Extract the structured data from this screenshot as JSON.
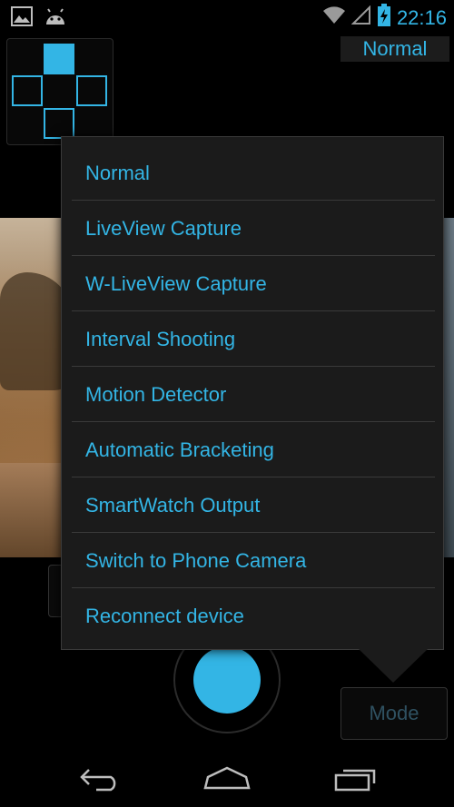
{
  "status_bar": {
    "time": "22:16",
    "left_icons": [
      "gallery-notification-icon",
      "android-notification-icon"
    ],
    "right_icons": [
      "wifi-icon",
      "signal-icon",
      "battery-charging-icon"
    ]
  },
  "current_mode_label": "Normal",
  "dpad": {
    "buttons": [
      "up",
      "left",
      "right",
      "down"
    ],
    "active": "up"
  },
  "menu": {
    "items": [
      {
        "label": "Normal"
      },
      {
        "label": "LiveView Capture"
      },
      {
        "label": "W-LiveView Capture"
      },
      {
        "label": "Interval Shooting"
      },
      {
        "label": "Motion Detector"
      },
      {
        "label": "Automatic Bracketing"
      },
      {
        "label": "SmartWatch Output"
      },
      {
        "label": "Switch to Phone Camera"
      },
      {
        "label": "Reconnect device"
      }
    ]
  },
  "mode_button_label": "Mode",
  "nav_bar": {
    "icons": [
      "back-icon",
      "home-icon",
      "recents-icon"
    ]
  },
  "colors": {
    "accent": "#33b5e5",
    "menu_bg": "#1b1b1b",
    "divider": "#3a3a3a"
  }
}
